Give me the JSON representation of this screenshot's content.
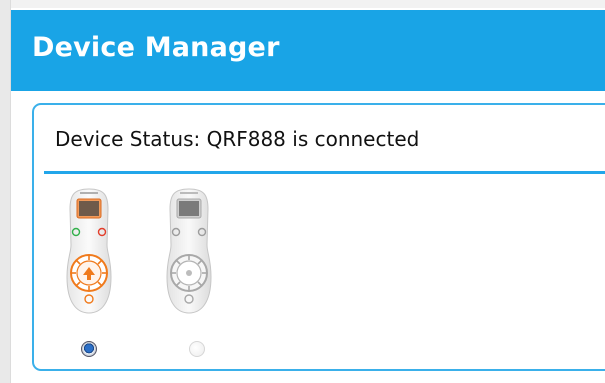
{
  "window": {
    "title": "Device Manager"
  },
  "panel": {
    "status_text": "Device Status: QRF888 is connected"
  },
  "devices": [
    {
      "icon": "remote-orange-icon",
      "selected": true
    },
    {
      "icon": "remote-gray-icon",
      "selected": false
    }
  ],
  "colors": {
    "titlebar": "#19a4e6",
    "accent_border": "#3ab0ea",
    "remote_accent": "#f07a1c"
  }
}
